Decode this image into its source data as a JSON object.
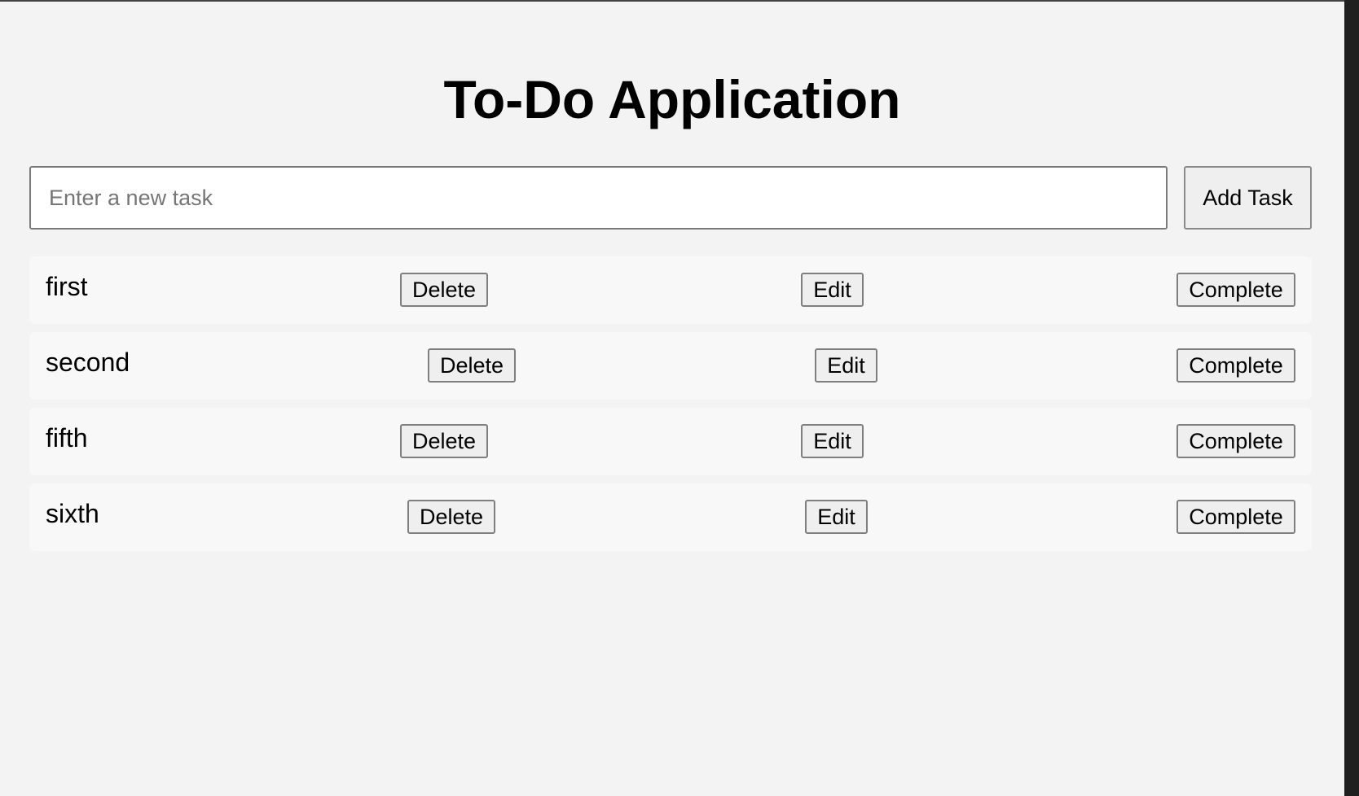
{
  "app": {
    "title": "To-Do Application"
  },
  "new_task": {
    "placeholder": "Enter a new task",
    "value": "",
    "add_label": "Add Task"
  },
  "tasks": [
    {
      "name": "first",
      "delete_label": "Delete",
      "edit_label": "Edit",
      "complete_label": "Complete"
    },
    {
      "name": "second",
      "delete_label": "Delete",
      "edit_label": "Edit",
      "complete_label": "Complete"
    },
    {
      "name": "fifth",
      "delete_label": "Delete",
      "edit_label": "Edit",
      "complete_label": "Complete"
    },
    {
      "name": "sixth",
      "delete_label": "Delete",
      "edit_label": "Edit",
      "complete_label": "Complete"
    }
  ],
  "colors": {
    "page_background": "#f3f3f3",
    "row_background": "#f8f8f8",
    "button_background": "#efefef",
    "text": "#000000"
  }
}
